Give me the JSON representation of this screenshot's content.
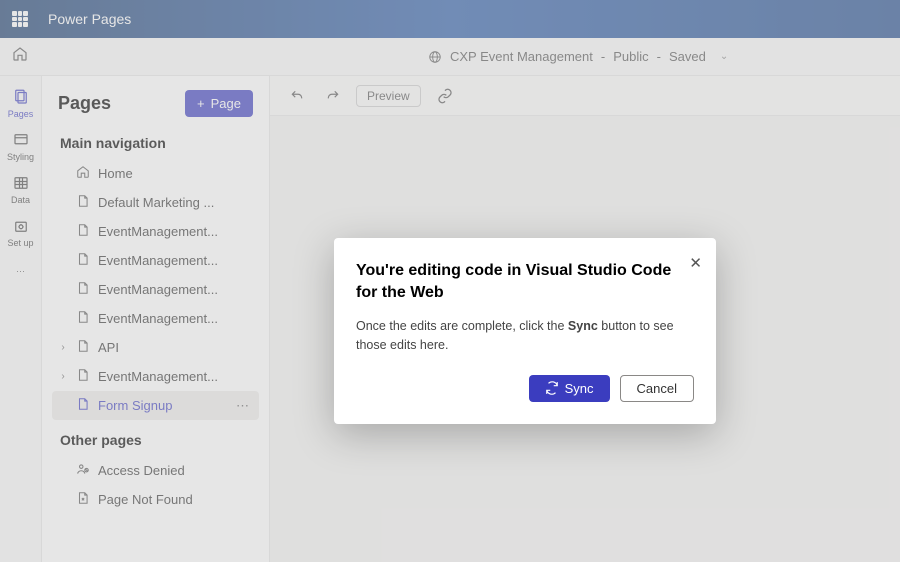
{
  "header": {
    "product": "Power Pages"
  },
  "subheader": {
    "site_name": "CXP Event Management",
    "visibility": "Public",
    "status": "Saved"
  },
  "rail": {
    "items": [
      {
        "key": "pages",
        "label": "Pages"
      },
      {
        "key": "styling",
        "label": "Styling"
      },
      {
        "key": "data",
        "label": "Data"
      },
      {
        "key": "setup",
        "label": "Set up"
      }
    ]
  },
  "side": {
    "title": "Pages",
    "add_page": "Page",
    "sections": {
      "main_nav": "Main navigation",
      "other": "Other pages"
    },
    "main_nav_items": [
      {
        "icon": "home",
        "label": "Home"
      },
      {
        "icon": "page",
        "label": "Default Marketing ..."
      },
      {
        "icon": "page",
        "label": "EventManagement..."
      },
      {
        "icon": "page",
        "label": "EventManagement..."
      },
      {
        "icon": "page",
        "label": "EventManagement..."
      },
      {
        "icon": "page",
        "label": "EventManagement..."
      },
      {
        "icon": "page",
        "label": "API",
        "expandable": true
      },
      {
        "icon": "page",
        "label": "EventManagement...",
        "expandable": true
      },
      {
        "icon": "page",
        "label": "Form Signup",
        "selected": true
      }
    ],
    "other_items": [
      {
        "icon": "denied",
        "label": "Access Denied"
      },
      {
        "icon": "notfound",
        "label": "Page Not Found"
      }
    ]
  },
  "toolbar": {
    "preview": "Preview"
  },
  "modal": {
    "title": "You're editing code in Visual Studio Code for the Web",
    "body_pre": "Once the edits are complete, click the ",
    "body_bold": "Sync",
    "body_post": " button to see those edits here.",
    "sync": "Sync",
    "cancel": "Cancel"
  }
}
